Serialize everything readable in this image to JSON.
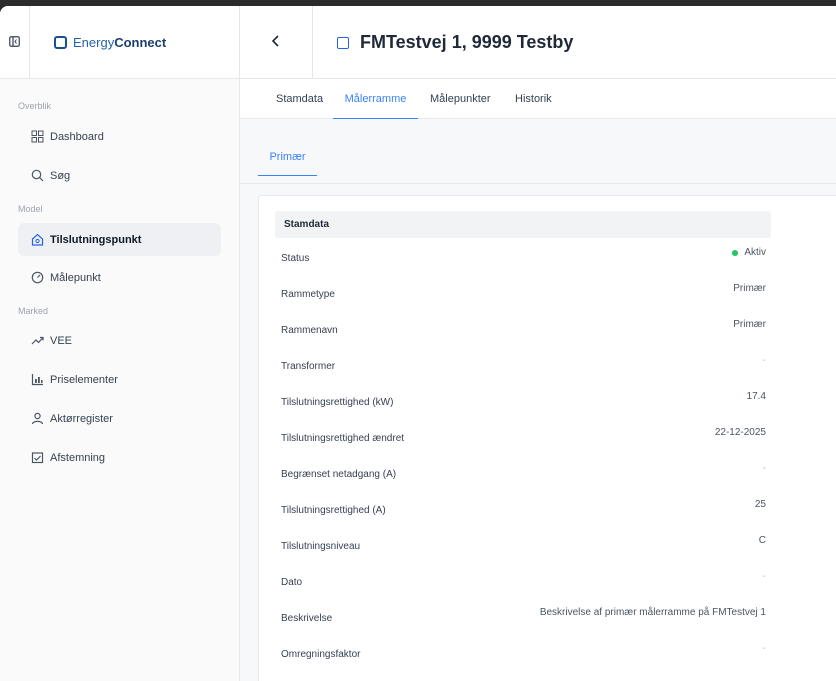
{
  "brand": {
    "name_part1": "Energy",
    "name_part2": "Connect"
  },
  "page": {
    "title": "FMTestvej 1, 9999 Testby"
  },
  "sidebar": {
    "sections": [
      {
        "label": "Overblik"
      },
      {
        "label": "Model"
      },
      {
        "label": "Marked"
      }
    ],
    "items": [
      {
        "label": "Dashboard",
        "icon": "grid-icon"
      },
      {
        "label": "Søg",
        "icon": "search-icon"
      },
      {
        "label": "Tilslutningspunkt",
        "icon": "home-icon",
        "active": true
      },
      {
        "label": "Målepunkt",
        "icon": "gauge-icon"
      },
      {
        "label": "VEE",
        "icon": "trend-icon"
      },
      {
        "label": "Priselementer",
        "icon": "chart-icon"
      },
      {
        "label": "Aktørregister",
        "icon": "user-icon"
      },
      {
        "label": "Afstemning",
        "icon": "check-chart-icon"
      }
    ]
  },
  "tabs": [
    {
      "label": "Stamdata"
    },
    {
      "label": "Målerramme",
      "active": true
    },
    {
      "label": "Målepunkter"
    },
    {
      "label": "Historik"
    }
  ],
  "subtab": {
    "label": "Primær"
  },
  "card": {
    "title": "Stamdata",
    "rows": [
      {
        "label": "Status",
        "value": "Aktiv"
      },
      {
        "label": "Rammetype",
        "value": "Primær"
      },
      {
        "label": "Rammenavn",
        "value": "Primær"
      },
      {
        "label": "Transformer",
        "value": "-"
      },
      {
        "label": "Tilslutningsrettighed (kW)",
        "value": "17.4"
      },
      {
        "label": "Tilslutningsrettighed ændret",
        "value": "22-12-2025"
      },
      {
        "label": "Begrænset netadgang (A)",
        "value": "-"
      },
      {
        "label": "Tilslutningsrettighed (A)",
        "value": "25"
      },
      {
        "label": "Tilslutningsniveau",
        "value": "C"
      },
      {
        "label": "Dato",
        "value": "-"
      },
      {
        "label": "Beskrivelse",
        "value": "Beskrivelse af primær målerramme på FMTestvej 1"
      },
      {
        "label": "Omregningsfaktor",
        "value": "-"
      }
    ]
  },
  "colors": {
    "accent": "#3b82f6",
    "status_active": "#22c55e",
    "brand": "#1d4f8c"
  }
}
